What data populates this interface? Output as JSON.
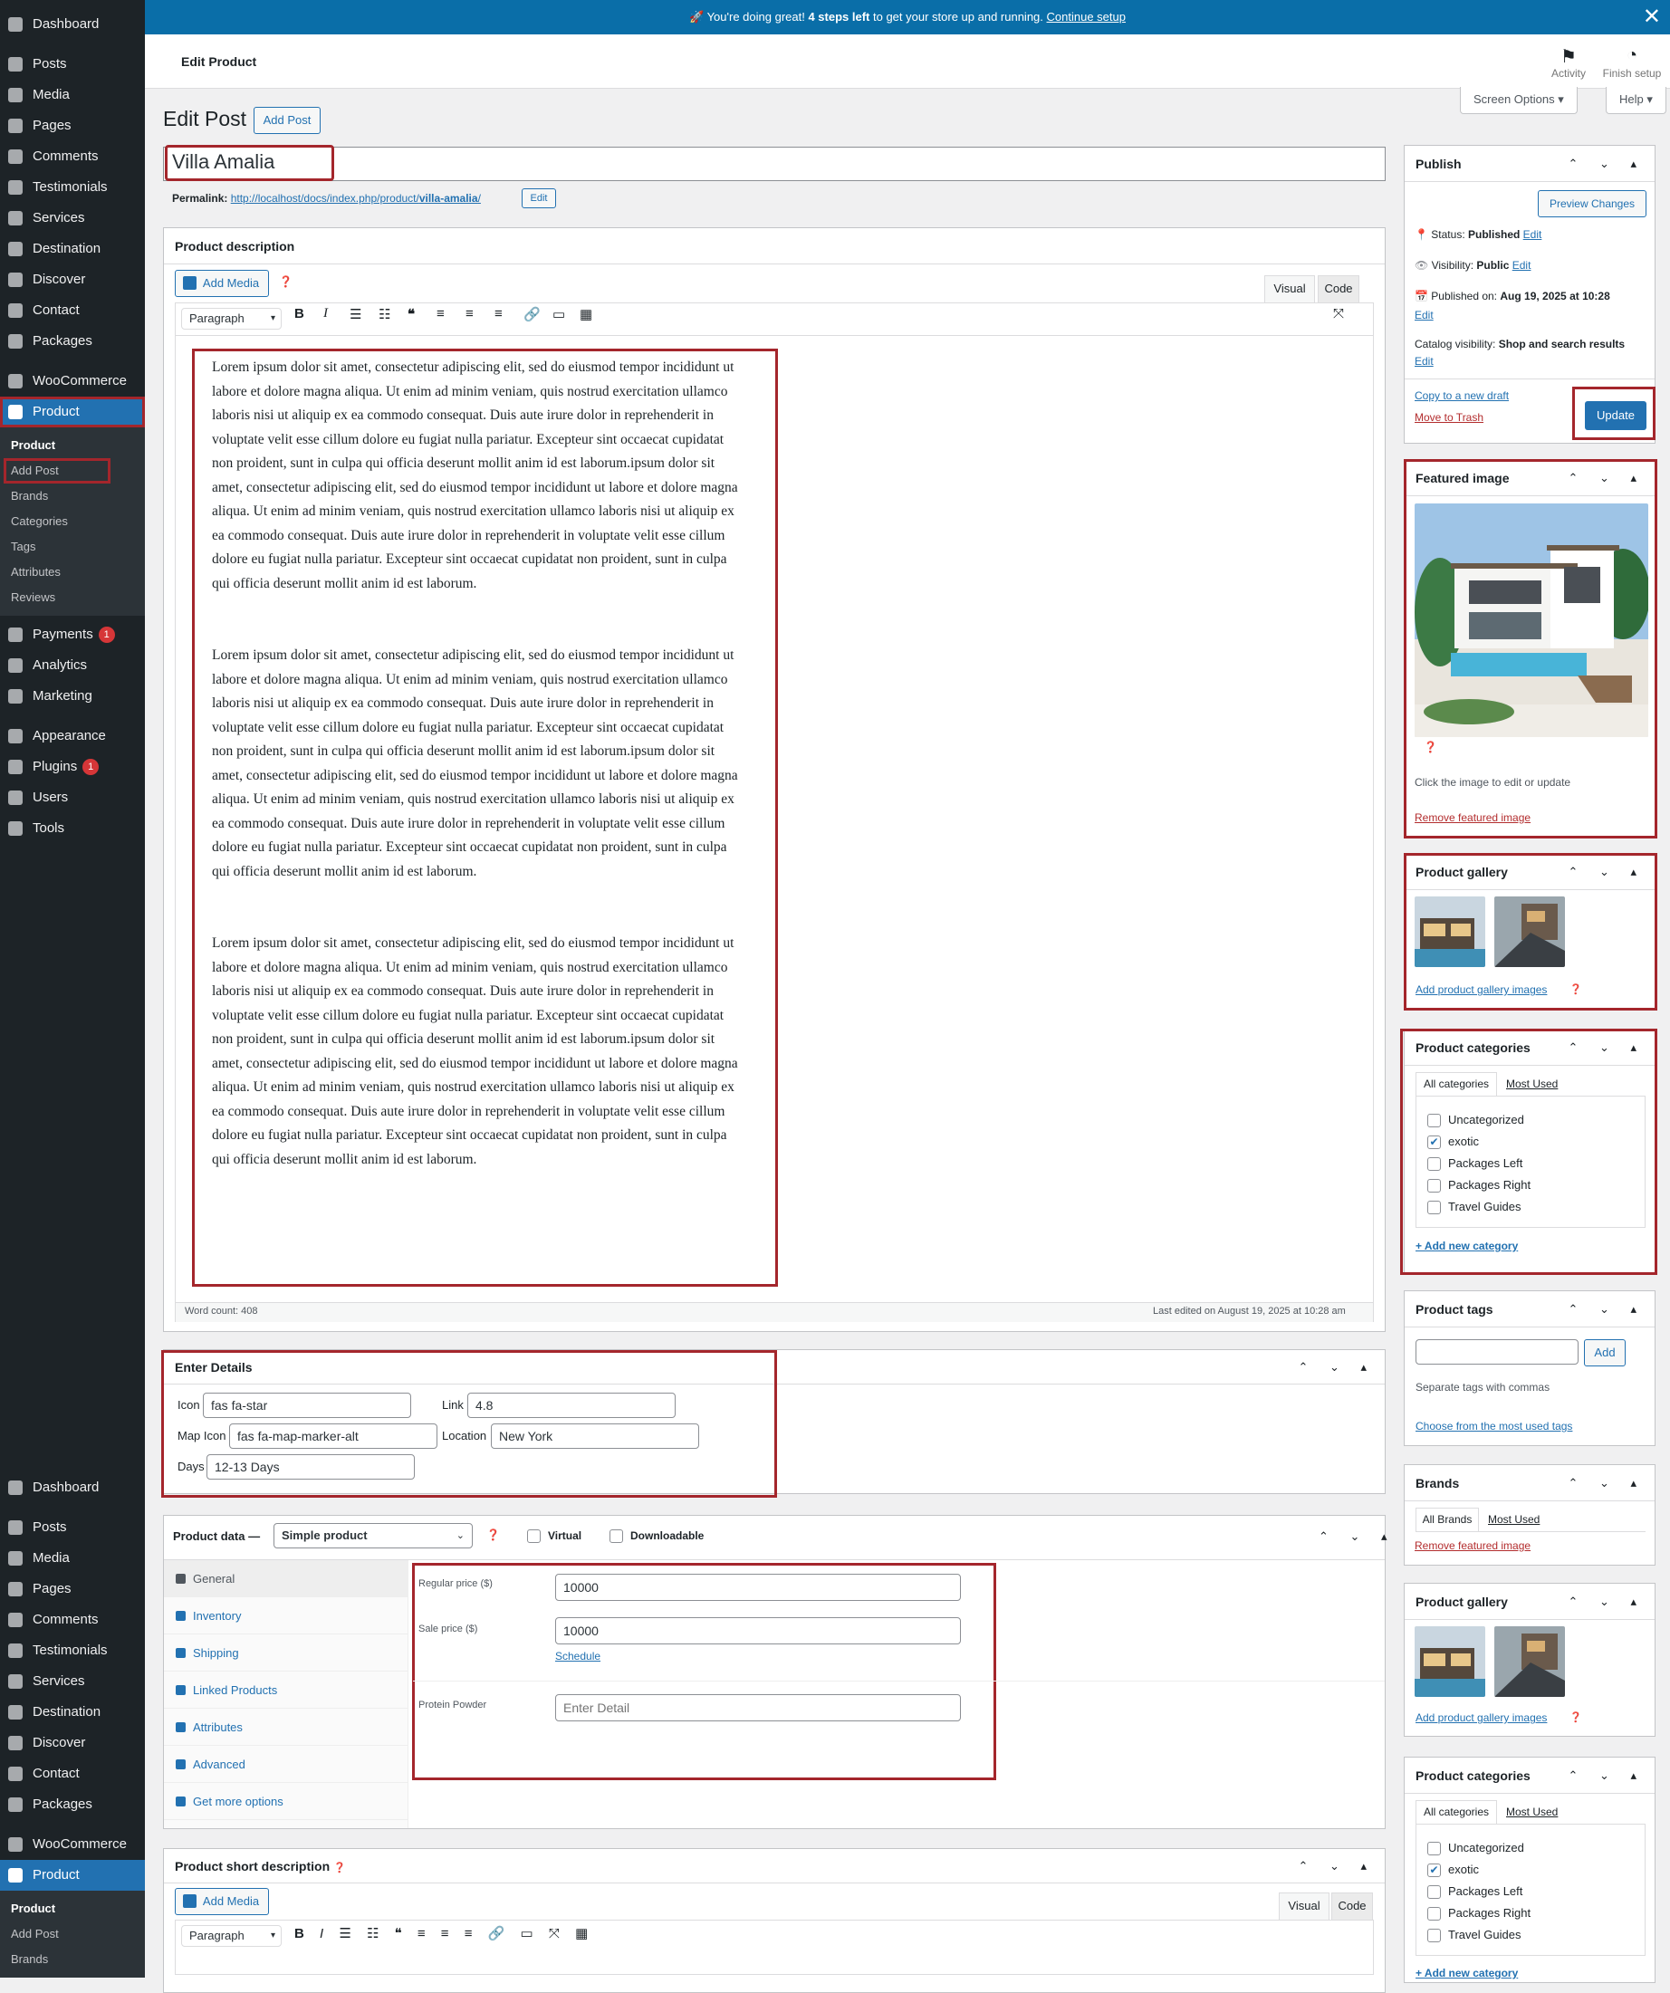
{
  "notice": {
    "prefix": "🚀 You're doing great! ",
    "bold": "4 steps left",
    "mid": " to get your store up and running. ",
    "link": "Continue setup"
  },
  "topbar": {
    "title": "Edit Product",
    "activity": "Activity",
    "finish": "Finish setup",
    "screen_options": "Screen Options ▾",
    "help": "Help ▾"
  },
  "sidebar": {
    "top": [
      {
        "label": "Dashboard"
      },
      {
        "label": "Posts"
      },
      {
        "label": "Media"
      },
      {
        "label": "Pages"
      },
      {
        "label": "Comments"
      },
      {
        "label": "Testimonials"
      },
      {
        "label": "Services"
      },
      {
        "label": "Destination"
      },
      {
        "label": "Discover"
      },
      {
        "label": "Contact"
      },
      {
        "label": "Packages"
      }
    ],
    "woocommerce": "WooCommerce",
    "product": "Product",
    "sub": [
      "Product",
      "Add Post",
      "Brands",
      "Categories",
      "Tags",
      "Attributes",
      "Reviews"
    ],
    "payments": "Payments",
    "payments_badge": "1",
    "analytics": "Analytics",
    "marketing": "Marketing",
    "appearance": "Appearance",
    "plugins": "Plugins",
    "plugins_badge": "1",
    "users": "Users",
    "tools": "Tools",
    "sub2": [
      "Product",
      "Add Post",
      "Brands"
    ]
  },
  "page": {
    "heading": "Edit Post",
    "add_post": "Add Post",
    "title_value": "Villa Amalia",
    "permalink_label": "Permalink:",
    "permalink_base": "http://localhost/docs/index.php/product/",
    "permalink_slug": "villa-amalia",
    "permalink_end": "/",
    "permalink_edit": "Edit"
  },
  "editor": {
    "box_title": "Product description",
    "add_media": "Add Media",
    "visual": "Visual",
    "code": "Code",
    "format": "Paragraph",
    "word_count": "Word count: 408",
    "last_edited": "Last edited on August 19, 2025 at 10:28 am",
    "paragraphs": [
      "Lorem ipsum dolor sit amet, consectetur adipiscing elit, sed do eiusmod tempor incididunt ut labore et dolore magna aliqua. Ut enim ad minim veniam, quis nostrud exercitation ullamco laboris nisi ut aliquip ex ea commodo consequat. Duis aute irure dolor in reprehenderit in voluptate velit esse cillum dolore eu fugiat nulla pariatur. Excepteur sint occaecat cupidatat non proident, sunt in culpa qui officia deserunt mollit anim id est laborum.ipsum dolor sit amet, consectetur adipiscing elit, sed do eiusmod tempor incididunt ut labore et dolore magna aliqua. Ut enim ad minim veniam, quis nostrud exercitation ullamco laboris nisi ut aliquip ex ea commodo consequat. Duis aute irure dolor in reprehenderit in voluptate velit esse cillum dolore eu fugiat nulla pariatur. Excepteur sint occaecat cupidatat non proident, sunt in culpa qui officia deserunt mollit anim id est laborum.",
      "Lorem ipsum dolor sit amet, consectetur adipiscing elit, sed do eiusmod tempor incididunt ut labore et dolore magna aliqua. Ut enim ad minim veniam, quis nostrud exercitation ullamco laboris nisi ut aliquip ex ea commodo consequat. Duis aute irure dolor in reprehenderit in voluptate velit esse cillum dolore eu fugiat nulla pariatur. Excepteur sint occaecat cupidatat non proident, sunt in culpa qui officia deserunt mollit anim id est laborum.ipsum dolor sit amet, consectetur adipiscing elit, sed do eiusmod tempor incididunt ut labore et dolore magna aliqua. Ut enim ad minim veniam, quis nostrud exercitation ullamco laboris nisi ut aliquip ex ea commodo consequat. Duis aute irure dolor in reprehenderit in voluptate velit esse cillum dolore eu fugiat nulla pariatur. Excepteur sint occaecat cupidatat non proident, sunt in culpa qui officia deserunt mollit anim id est laborum.",
      "Lorem ipsum dolor sit amet, consectetur adipiscing elit, sed do eiusmod tempor incididunt ut labore et dolore magna aliqua. Ut enim ad minim veniam, quis nostrud exercitation ullamco laboris nisi ut aliquip ex ea commodo consequat. Duis aute irure dolor in reprehenderit in voluptate velit esse cillum dolore eu fugiat nulla pariatur. Excepteur sint occaecat cupidatat non proident, sunt in culpa qui officia deserunt mollit anim id est laborum.ipsum dolor sit amet, consectetur adipiscing elit, sed do eiusmod tempor incididunt ut labore et dolore magna aliqua. Ut enim ad minim veniam, quis nostrud exercitation ullamco laboris nisi ut aliquip ex ea commodo consequat. Duis aute irure dolor in reprehenderit in voluptate velit esse cillum dolore eu fugiat nulla pariatur. Excepteur sint occaecat cupidatat non proident, sunt in culpa qui officia deserunt mollit anim id est laborum."
    ]
  },
  "details": {
    "title": "Enter Details",
    "icon_label": "Icon",
    "icon_value": "fas fa-star",
    "link_label": "Link",
    "link_value": "4.8",
    "map_label": "Map Icon",
    "map_value": "fas fa-map-marker-alt",
    "location_label": "Location",
    "location_value": "New York",
    "days_label": "Days",
    "days_value": "12-13 Days"
  },
  "product_data": {
    "label": "Product data —",
    "type": "Simple product",
    "virtual": "Virtual",
    "downloadable": "Downloadable",
    "tabs": [
      "General",
      "Inventory",
      "Shipping",
      "Linked Products",
      "Attributes",
      "Advanced",
      "Get more options"
    ],
    "regular_label": "Regular price ($)",
    "regular_value": "10000",
    "sale_label": "Sale price ($)",
    "sale_value": "10000",
    "schedule": "Schedule",
    "protein_label": "Protein Powder",
    "protein_placeholder": "Enter Detail"
  },
  "short_desc": {
    "title": "Product short description",
    "add_media": "Add Media",
    "visual": "Visual",
    "code": "Code",
    "format": "Paragraph"
  },
  "publish": {
    "title": "Publish",
    "preview": "Preview Changes",
    "status_label": "Status: ",
    "status_value": "Published",
    "visibility_label": "Visibility: ",
    "visibility_value": "Public",
    "published_label": "Published on: ",
    "published_value": "Aug 19, 2025 at 10:28",
    "catalog_label": "Catalog visibility: ",
    "catalog_value": "Shop and search results",
    "edit": "Edit",
    "copy_draft": "Copy to a new draft",
    "trash": "Move to Trash",
    "update": "Update"
  },
  "featured": {
    "title": "Featured image",
    "hint": "Click the image to edit or update",
    "remove": "Remove featured image"
  },
  "gallery": {
    "title": "Product gallery",
    "add": "Add product gallery images"
  },
  "categories": {
    "title": "Product categories",
    "tab_all": "All categories",
    "tab_most": "Most Used",
    "items": [
      {
        "label": "Uncategorized",
        "checked": false
      },
      {
        "label": "exotic",
        "checked": true
      },
      {
        "label": "Packages Left",
        "checked": false
      },
      {
        "label": "Packages Right",
        "checked": false
      },
      {
        "label": "Travel Guides",
        "checked": false
      }
    ],
    "add_new": "+ Add new category"
  },
  "tags": {
    "title": "Product tags",
    "add": "Add",
    "hint": "Separate tags with commas",
    "choose": "Choose from the most used tags"
  },
  "brands": {
    "title": "Brands",
    "tab_all": "All Brands",
    "tab_most": "Most Used",
    "remove": "Remove featured image"
  },
  "colors": {
    "accent": "#2271b1",
    "sidebar": "#1d2327",
    "notice": "#0a6ea8",
    "highlight": "#a4262c"
  }
}
